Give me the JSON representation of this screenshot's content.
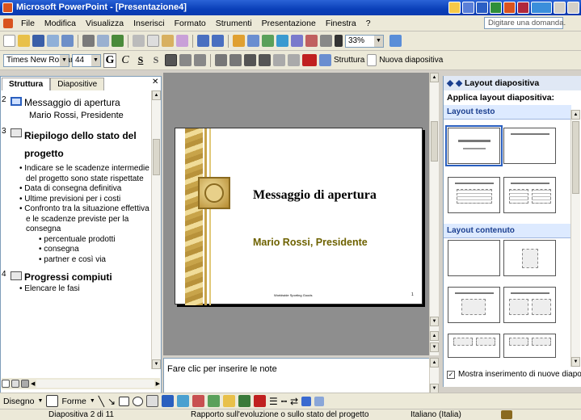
{
  "window": {
    "title": "Microsoft PowerPoint - [Presentazione4]"
  },
  "menu": {
    "items": [
      "File",
      "Modifica",
      "Visualizza",
      "Inserisci",
      "Formato",
      "Strumenti",
      "Presentazione",
      "Finestra",
      "?"
    ],
    "help_placeholder": "Digitare una domanda."
  },
  "toolbar": {
    "zoom": "33%"
  },
  "format_toolbar": {
    "font": "Times New Roman",
    "size": "44",
    "bold": "G",
    "italic": "C",
    "underline": "S",
    "shadow": "S",
    "structure_label": "Struttura",
    "new_slide_label": "Nuova diapositiva"
  },
  "left_panel": {
    "tabs": [
      "Struttura",
      "Diapositive"
    ],
    "outline": [
      {
        "num": "2",
        "title": "Messaggio di apertura",
        "subtitle": "Mario Rossi, Presidente"
      },
      {
        "num": "3",
        "title": "Riepilogo dello stato del progetto",
        "bullets": [
          "Indicare se le scadenze intermedie del progetto sono state rispettate",
          "Data di consegna definitiva",
          "Ultime previsioni per i costi",
          "Confronto tra la situazione effettiva e le scadenze previste per la consegna"
        ],
        "sub_bullets": [
          "percentuale prodotti",
          "consegna",
          "partner e così via"
        ]
      },
      {
        "num": "4",
        "title": "Progressi compiuti",
        "peek": "Elencare le fasi"
      }
    ]
  },
  "slide": {
    "title": "Messaggio di apertura",
    "subtitle": "Mario Rossi, Presidente",
    "footer": "Worldwide Sporting Goods",
    "page": "1"
  },
  "notes": {
    "placeholder": "Fare clic per inserire le note"
  },
  "right_panel": {
    "header": "Layout diapositiva",
    "subheader": "Applica layout diapositiva:",
    "section_text": "Layout testo",
    "section_content": "Layout contenuto",
    "checkbox_label": "Mostra inserimento di nuove diapositive"
  },
  "draw_toolbar": {
    "draw": "Disegno",
    "shapes": "Forme"
  },
  "status": {
    "slide": "Diapositiva 2 di 11",
    "template": "Rapporto sull'evoluzione o sullo stato del progetto",
    "language": "Italiano (Italia)"
  },
  "colors": {
    "titlebar": "#0a3fb8",
    "gold": "#c8a44a",
    "accent": "#2a5fbf"
  }
}
